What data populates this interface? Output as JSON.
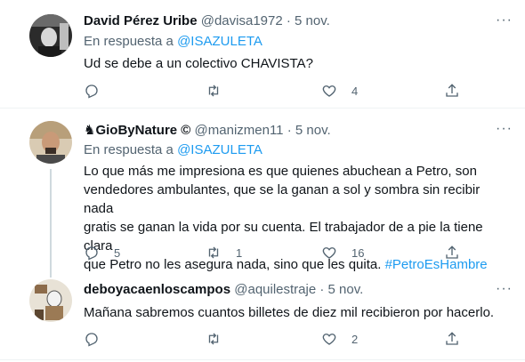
{
  "tweets": [
    {
      "name": "David Pérez Uribe",
      "handle": "@davisa1972",
      "time": "5 nov.",
      "reply_prefix": "En respuesta a",
      "reply_to": "@ISAZULETA",
      "text": "Ud se debe a un colectivo CHAVISTA?",
      "replies": "",
      "retweets": "",
      "likes": "4"
    },
    {
      "name": "♞GioByNature ©",
      "handle": "@manizmen11",
      "time": "5 nov.",
      "reply_prefix": "En respuesta a",
      "reply_to": "@ISAZULETA",
      "lines": [
        "Lo que más me impresiona es que quienes abuchean a Petro, son",
        "vendedores ambulantes, que se la ganan a sol y sombra sin recibir nada",
        "gratis  se ganan la vida por su cuenta. El trabajador de a pie la  tiene clara",
        "que Petro no les asegura nada, sino que les quita. "
      ],
      "hashtag": "#PetroEsHambre",
      "replies": "5",
      "retweets": "1",
      "likes": "16"
    },
    {
      "name": "deboyacaenloscampos",
      "handle": "@aquilestraje",
      "time": "5 nov.",
      "text": "Mañana sabremos cuantos billetes de diez mil recibieron por hacerlo.",
      "replies": "",
      "retweets": "",
      "likes": "2"
    }
  ],
  "separator": "·",
  "more_glyph": "···"
}
